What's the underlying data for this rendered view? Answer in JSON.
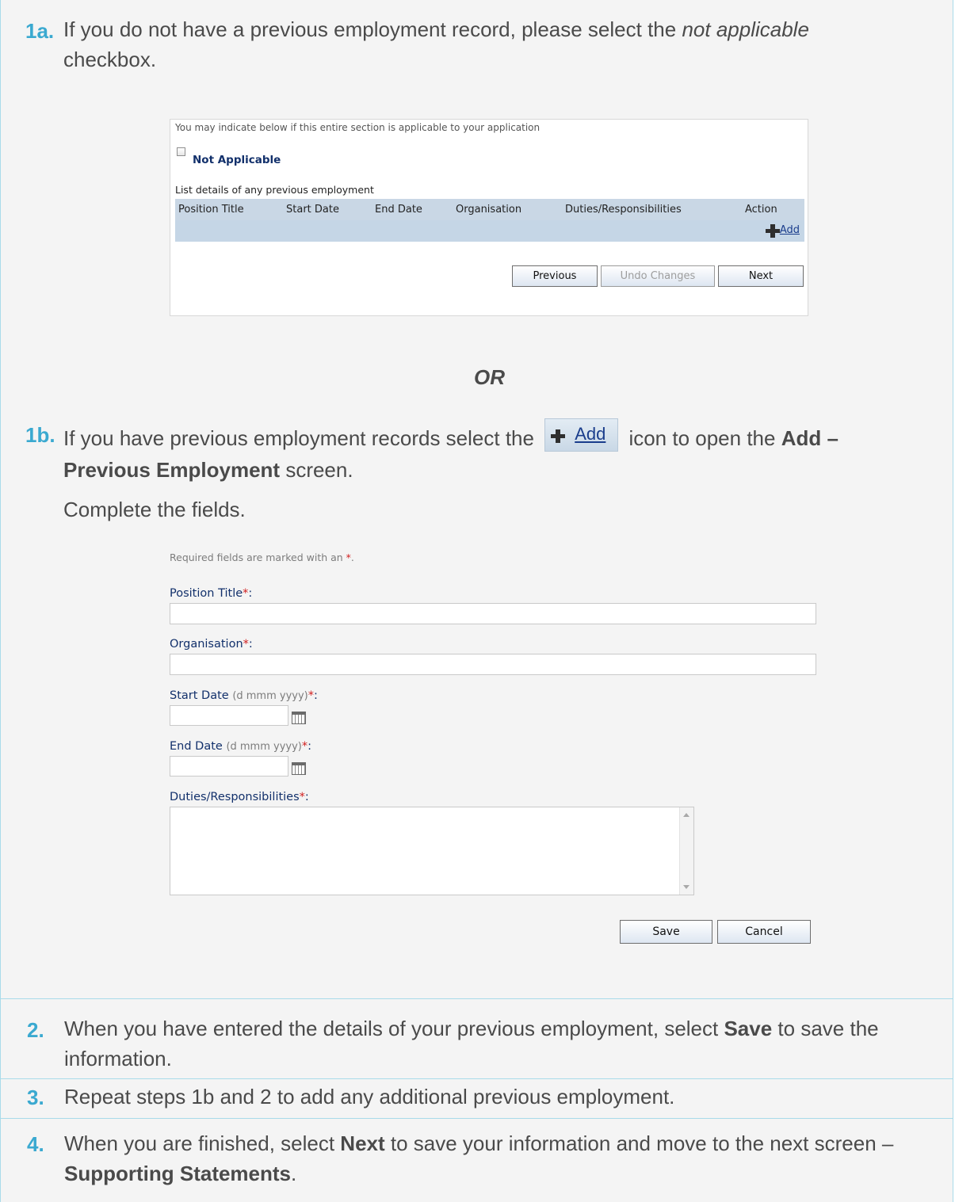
{
  "step1a": {
    "number": "1a.",
    "text_before": "If you do not have a previous employment record, please select the ",
    "text_italic": "not applicable",
    "text_after": "checkbox."
  },
  "screen1": {
    "intro": "You may indicate below if this entire section is applicable to your application",
    "not_applicable_label": "Not Applicable",
    "list_title": "List details of any previous employment",
    "columns": [
      "Position Title",
      "Start Date",
      "End Date",
      "Organisation",
      "Duties/Responsibilities",
      "Action"
    ],
    "add_link": "Add",
    "buttons": {
      "previous": "Previous",
      "undo": "Undo Changes",
      "next": "Next"
    }
  },
  "or_text": "OR",
  "step1b": {
    "number": "1b.",
    "text_before": "If you have previous employment records select the",
    "icon_label": "Add",
    "text_after": "icon to open the",
    "bold1": "Add –",
    "bold2": "Previous Employment",
    "text_end": "screen.",
    "complete": "Complete the fields."
  },
  "screen2": {
    "required_note": "Required fields are marked with an ",
    "required_star": "*",
    "required_end": ".",
    "position_title": "Position Title",
    "organisation": "Organisation",
    "start_date": "Start Date",
    "end_date": "End Date",
    "date_hint": "(d mmm yyyy)",
    "duties": "Duties/Responsibilities",
    "star": "*",
    "colon": ":",
    "save": "Save",
    "cancel": "Cancel"
  },
  "step2": {
    "number": "2.",
    "text_before": "When you have entered the details of your previous employment, select ",
    "bold": "Save",
    "text_after": " to save the information."
  },
  "step3": {
    "number": "3.",
    "text": "Repeat steps 1b and 2 to add any additional previous employment."
  },
  "step4": {
    "number": "4.",
    "text_before": "When you are finished, select ",
    "bold1": "Next",
    "text_mid": " to save your information and move to the next screen – ",
    "bold2": "Supporting Statements",
    "text_end": "."
  },
  "colors": {
    "accent": "#3aa9d0",
    "border": "#a9dbea",
    "label": "#12306b",
    "required": "#d12020"
  }
}
